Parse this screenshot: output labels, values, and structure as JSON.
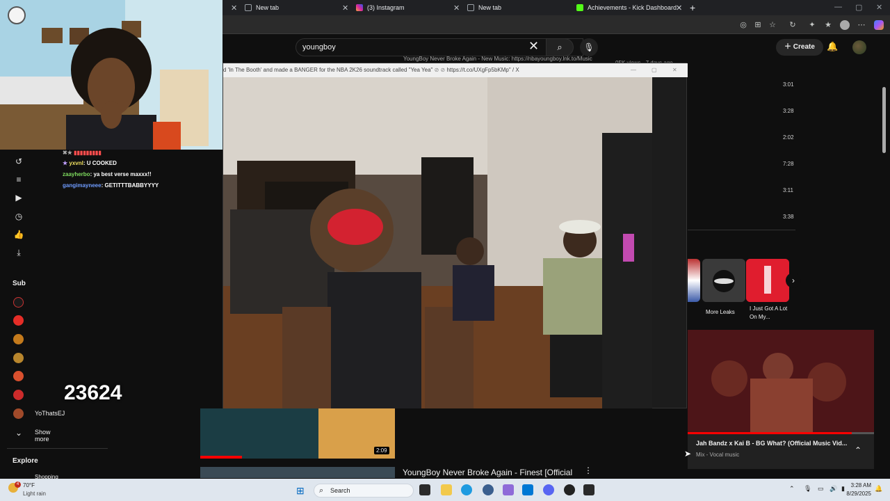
{
  "browser": {
    "tabs": [
      {
        "label": "New tab"
      },
      {
        "label": "(3) Instagram"
      },
      {
        "label": "New tab"
      },
      {
        "label": "Achievements - Kick Dashboard"
      }
    ]
  },
  "header": {
    "search_value": "youngboy",
    "create_label": "Create"
  },
  "chat": {
    "messages": [
      {
        "user": "yxvnl",
        "text": "U COOKED",
        "color": "#f0e060"
      },
      {
        "user": "zaayherbo",
        "text": "ya best verse maxxx!!",
        "color": "#7fdc5f"
      },
      {
        "user": "gangimayneee",
        "text": "GETITTTBABBYYYY",
        "color": "#6f9cff"
      }
    ]
  },
  "overlay": {
    "counter": "23624"
  },
  "player_window": {
    "title": "d 'In The Booth' and made a BANGER for the NBA 2K26 soundtrack called \"Yea Yea\"",
    "link": "https://t.co/UXgFp5bKMp\" / X",
    "behind_title": "YoungBoy Never Broke Again - New Music: https://nbayoungboy.lnk.to/Music",
    "behind_meta": "05K views · 7 days ago"
  },
  "sidebar": {
    "subscriptions_heading": "Sub",
    "channel_name": "YoThatsEJ",
    "show_more": "Show more",
    "explore_heading": "Explore",
    "explore_item": "Shopping"
  },
  "right_list": {
    "durations": [
      "3:01",
      "3:28",
      "2:02",
      "7:28",
      "3:11",
      "3:38"
    ]
  },
  "shelf": {
    "cards": [
      {
        "label": "More Leaks"
      },
      {
        "label": "I Just Got A Lot On My..."
      }
    ]
  },
  "miniplayer": {
    "title": "Jah Bandz x Kai B - BG What? (Official Music Vid...",
    "subtitle": "Mix - Vocal music",
    "progress": 0.88
  },
  "feed": {
    "video_duration": "2:09",
    "next_title": "YoungBoy Never Broke Again - Finest [Official"
  },
  "taskbar": {
    "weather_temp": "70°F",
    "weather_desc": "Light rain",
    "weather_badge": "4",
    "search_label": "Search",
    "time": "3:28 AM",
    "date": "8/29/2025"
  }
}
